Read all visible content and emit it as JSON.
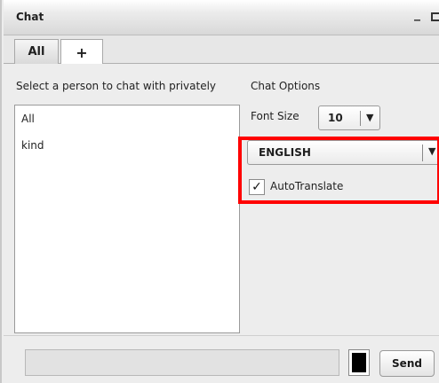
{
  "window": {
    "title": "Chat",
    "minimize_glyph": "_"
  },
  "tabs": [
    {
      "label": "All"
    },
    {
      "label": "+"
    }
  ],
  "people_panel": {
    "label": "Select a person to chat with privately",
    "items": [
      "All",
      "kind"
    ]
  },
  "options_panel": {
    "label": "Chat Options",
    "font_size_label": "Font Size",
    "font_size_value": "10",
    "language_value": "ENGLISH",
    "auto_translate_label": "AutoTranslate",
    "auto_translate_checked": true,
    "highlight_color": "#ff0000"
  },
  "composer": {
    "message_value": "",
    "text_color": "#000000",
    "send_label": "Send"
  }
}
